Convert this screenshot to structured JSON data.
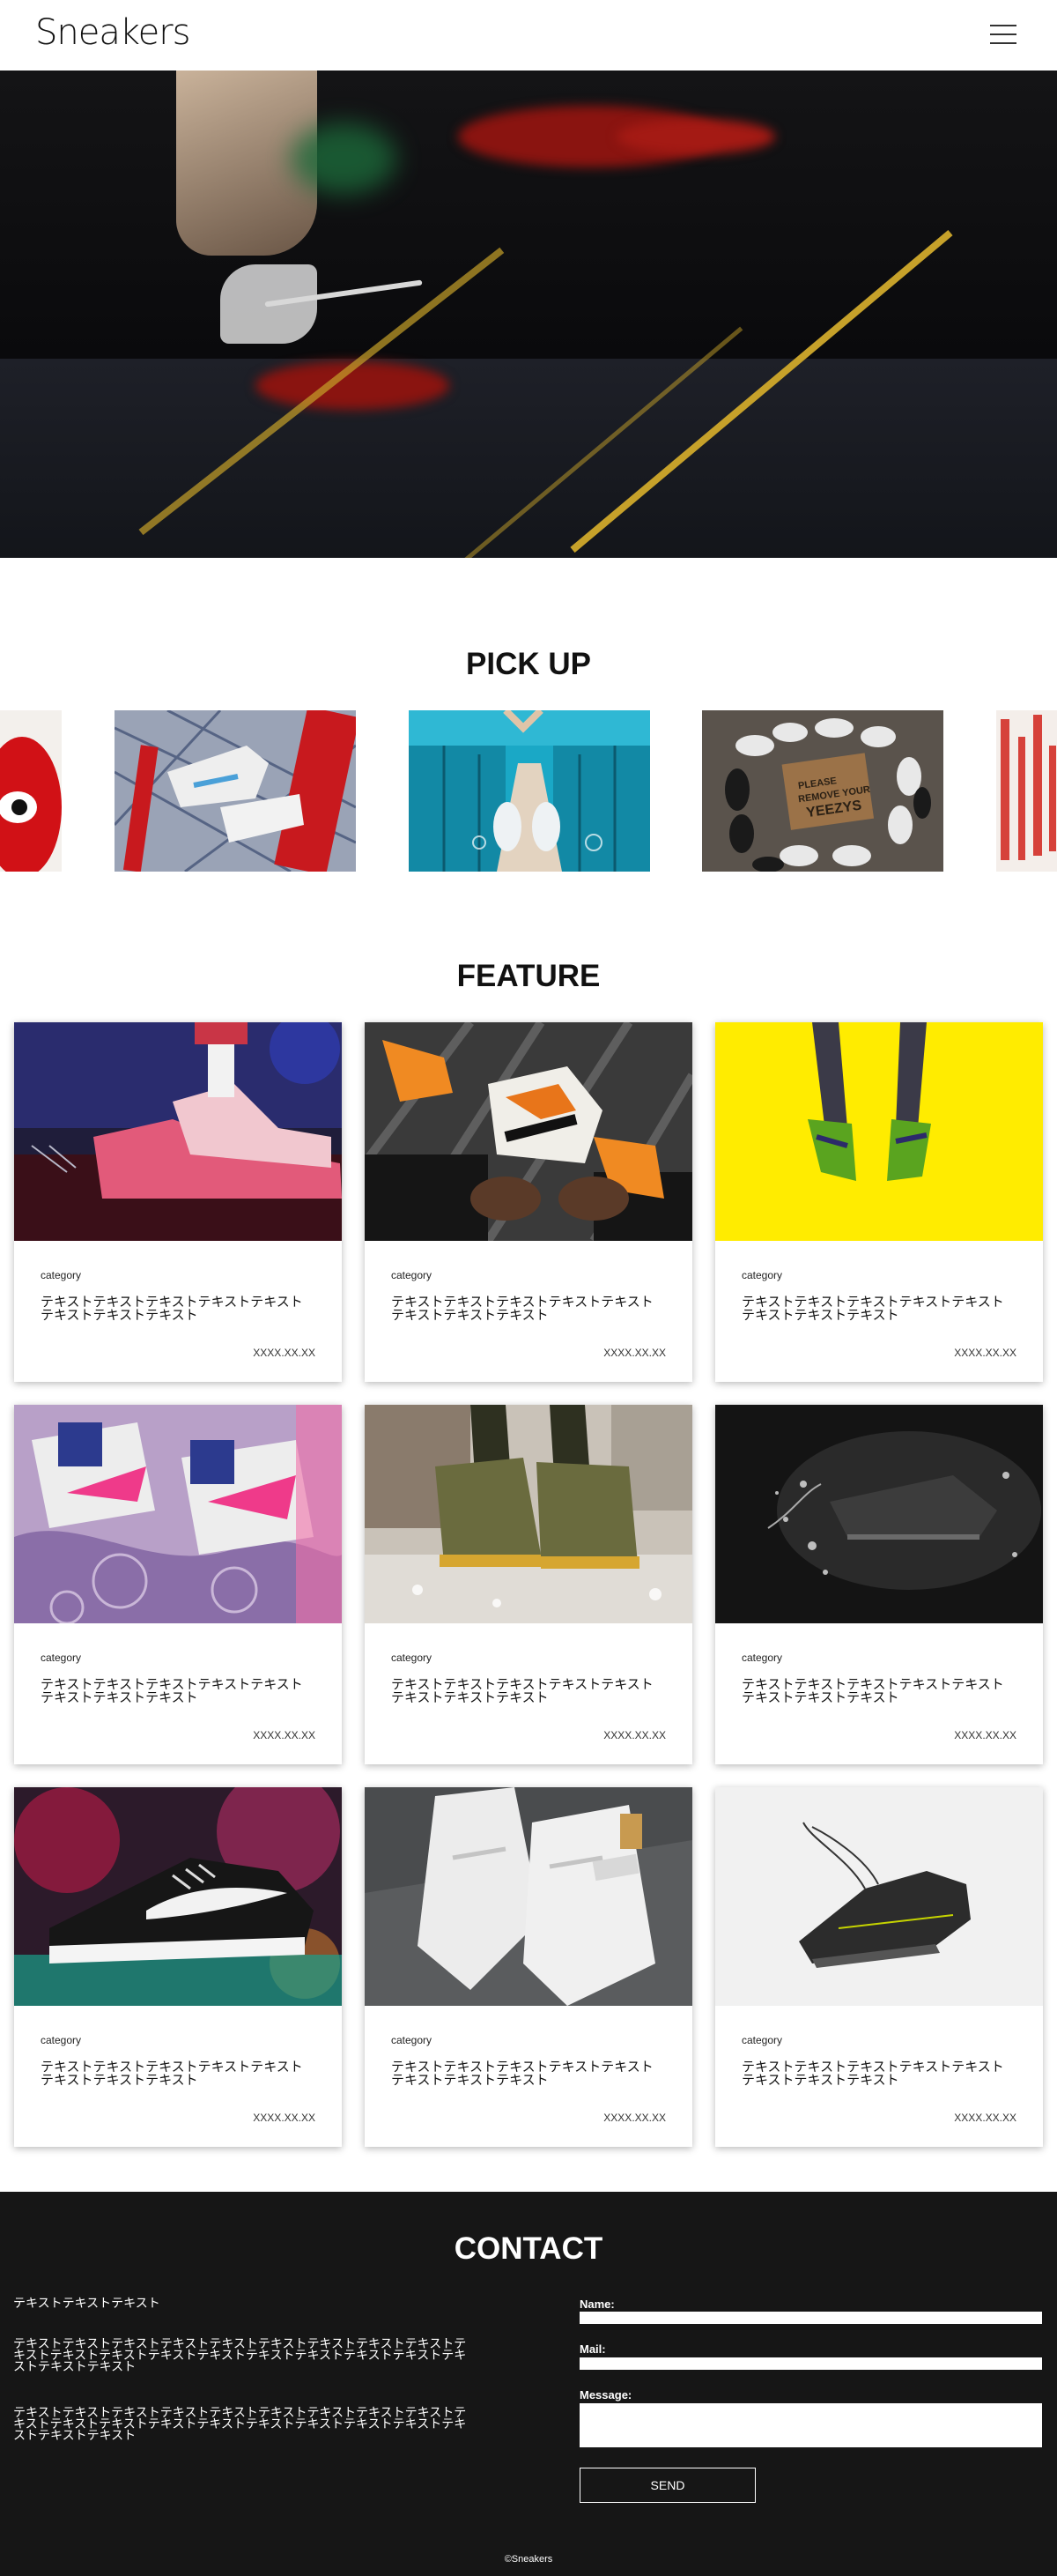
{
  "header": {
    "logo": "Sneakers",
    "menu_icon": "hamburger-menu-icon"
  },
  "hero": {
    "image": "sneaker-closeup-hero-photo"
  },
  "pickup": {
    "title": "PICK UP",
    "images": [
      "red-character-shoe-photo",
      "sneakers-with-red-banner-photo",
      "sneakers-held-on-blue-bridge-photo",
      "sneakers-around-doormat-photo",
      "red-white-pattern-photo"
    ]
  },
  "feature": {
    "title": "FEATURE",
    "cards": [
      {
        "image": "pink-lit-sneakers-photo",
        "category": "category",
        "title": "テキストテキストテキストテキストテキストテキストテキストテキスト",
        "date": "XXXX.XX.XX"
      },
      {
        "image": "orange-black-sneakers-in-hands-photo",
        "category": "category",
        "title": "テキストテキストテキストテキストテキストテキストテキストテキスト",
        "date": "XXXX.XX.XX"
      },
      {
        "image": "green-sneakers-yellow-background-photo",
        "category": "category",
        "title": "テキストテキストテキストテキストテキストテキストテキストテキスト",
        "date": "XXXX.XX.XX"
      },
      {
        "image": "pink-air-sneakers-photo",
        "category": "category",
        "title": "テキストテキストテキストテキストテキストテキストテキストテキスト",
        "date": "XXXX.XX.XX"
      },
      {
        "image": "olive-boots-splash-photo",
        "category": "category",
        "title": "テキストテキストテキストテキストテキストテキストテキストテキスト",
        "date": "XXXX.XX.XX"
      },
      {
        "image": "black-sneaker-water-splash-photo",
        "category": "category",
        "title": "テキストテキストテキストテキストテキストテキストテキストテキスト",
        "date": "XXXX.XX.XX"
      },
      {
        "image": "black-white-running-shoe-photo",
        "category": "category",
        "title": "テキストテキストテキストテキストテキストテキストテキストテキスト",
        "date": "XXXX.XX.XX"
      },
      {
        "image": "white-high-top-sneakers-photo",
        "category": "category",
        "title": "テキストテキストテキストテキストテキストテキストテキストテキスト",
        "date": "XXXX.XX.XX"
      },
      {
        "image": "black-shoe-floating-photo",
        "category": "category",
        "title": "テキストテキストテキストテキストテキストテキストテキストテキスト",
        "date": "XXXX.XX.XX"
      }
    ]
  },
  "contact": {
    "title": "CONTACT",
    "intro": "テキストテキストテキスト",
    "paragraph1": "テキストテキストテキストテキストテキストテキストテキストテキストテキストテキストテキストテキストテキストテキストテキストテキストテキストテキストテキストテキストテキスト",
    "paragraph2": "テキストテキストテキストテキストテキストテキストテキストテキストテキストテキストテキストテキストテキストテキストテキストテキストテキストテキストテキストテキストテキスト",
    "name_label": "Name:",
    "mail_label": "Mail:",
    "message_label": "Message:",
    "send_label": "SEND",
    "copyright": "©Sneakers"
  }
}
